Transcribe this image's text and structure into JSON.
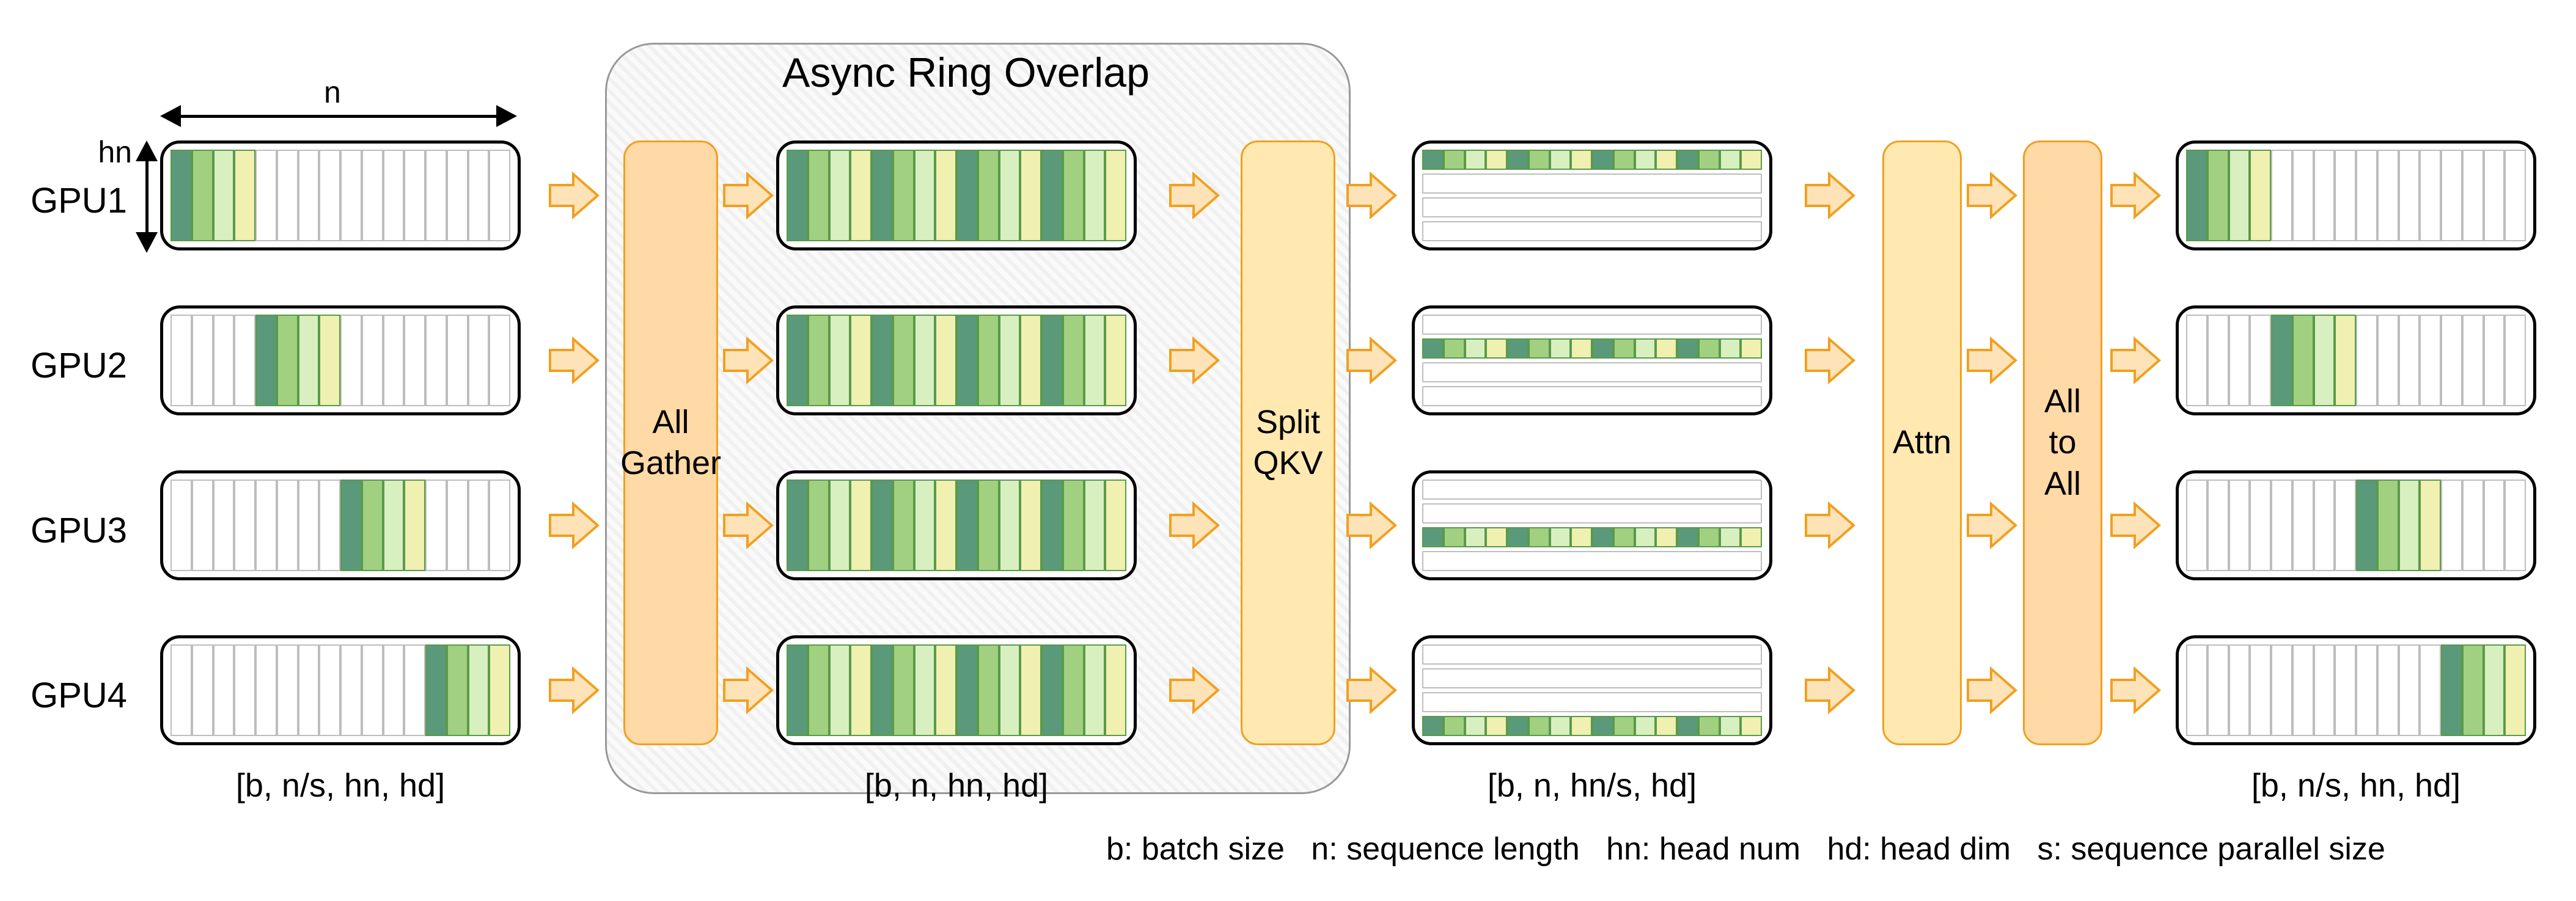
{
  "title": "Async Ring Overlap",
  "gpus": [
    "GPU1",
    "GPU2",
    "GPU3",
    "GPU4"
  ],
  "ops": {
    "allgather": "All\nGather",
    "splitqkv": "Split\nQKV",
    "attn": "Attn",
    "alltoall": "All\nto\nAll"
  },
  "shapes": {
    "stage1": "[b, n/s, hn, hd]",
    "stage2": "[b, n, hn, hd]",
    "stage3": "[b, n, hn/s, hd]",
    "stage5": "[b, n/s, hn, hd]"
  },
  "dims": {
    "n": "n",
    "hn": "hn"
  },
  "legend": "b: batch size   n: sequence length   hn: head num   hd: head dim   s: sequence parallel size"
}
